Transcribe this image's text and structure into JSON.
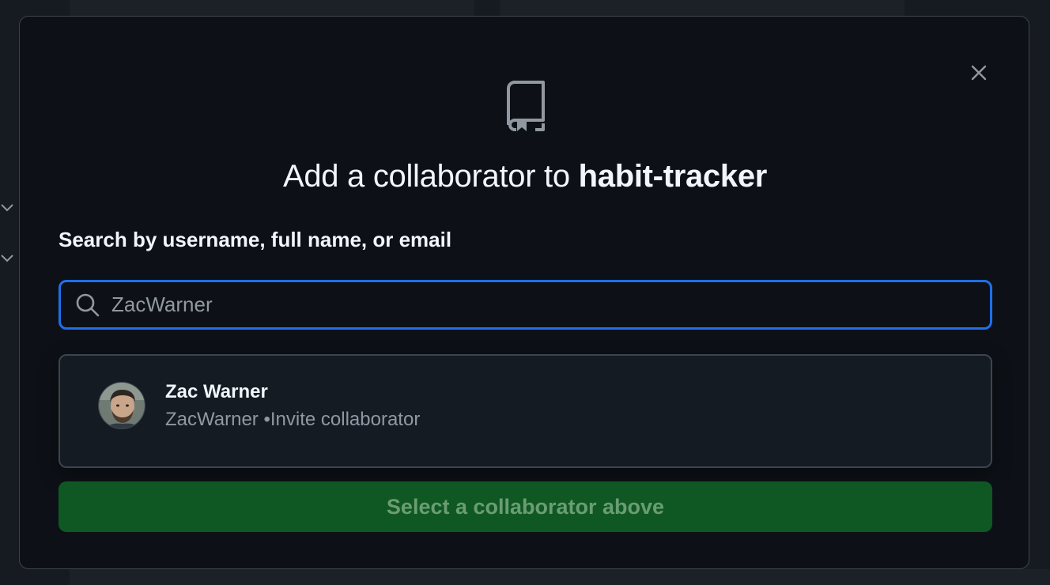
{
  "modal": {
    "title_prefix": "Add a collaborator to",
    "repo_name": "habit-tracker",
    "search_label": "Search by username, full name, or email",
    "search_value": "ZacWarner",
    "close_icon": "x-icon",
    "header_icon": "repo-icon"
  },
  "results": [
    {
      "name": "Zac Warner",
      "username": "ZacWarner",
      "action": "•Invite collaborator",
      "avatar_icon": "avatar-photo"
    }
  ],
  "submit": {
    "label": "Select a collaborator above",
    "disabled": true
  },
  "colors": {
    "accent_border": "#1f6feb",
    "button_bg": "#105823",
    "button_text": "#6a9d74",
    "modal_bg": "#0d1117"
  }
}
